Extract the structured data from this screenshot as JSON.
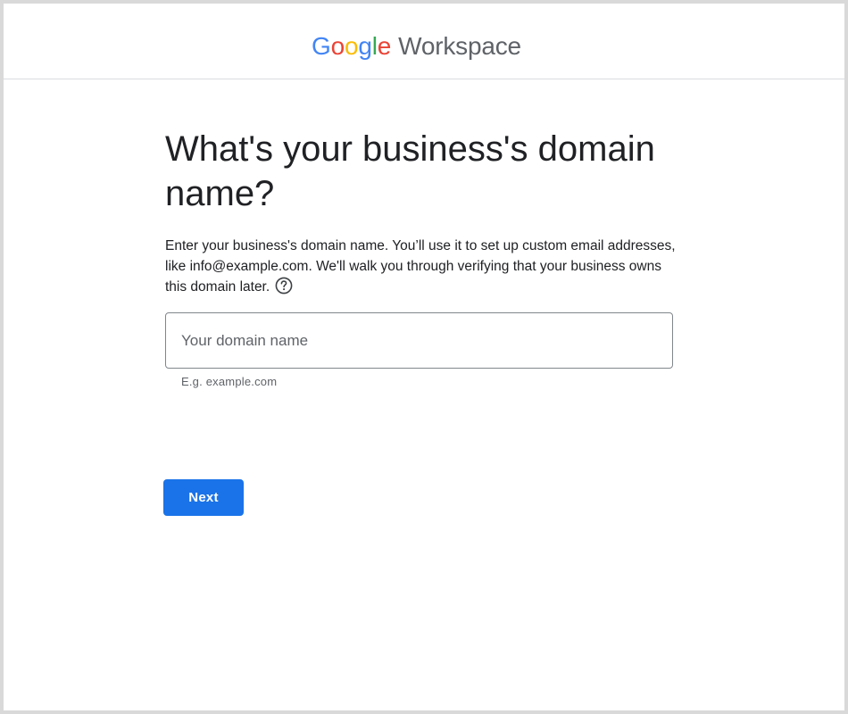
{
  "header": {
    "logo": {
      "letters": [
        "G",
        "o",
        "o",
        "g",
        "l",
        "e"
      ],
      "letter_colors": [
        "#4285F4",
        "#EA4335",
        "#FBBC05",
        "#4285F4",
        "#34A853",
        "#EA4335"
      ],
      "product": "Workspace",
      "product_color": "#5f6368"
    }
  },
  "main": {
    "title": "What's your business's domain name?",
    "description": "Enter your business's domain name. You’ll use it to set up custom email addresses, like info@example.com. We'll walk you through verifying that your business owns this domain later.",
    "help_icon": "help-circle-icon",
    "domain_field": {
      "value": "",
      "placeholder": "Your domain name",
      "hint": "E.g. example.com"
    },
    "next_button": {
      "label": "Next",
      "color": "#1a73e8"
    }
  }
}
